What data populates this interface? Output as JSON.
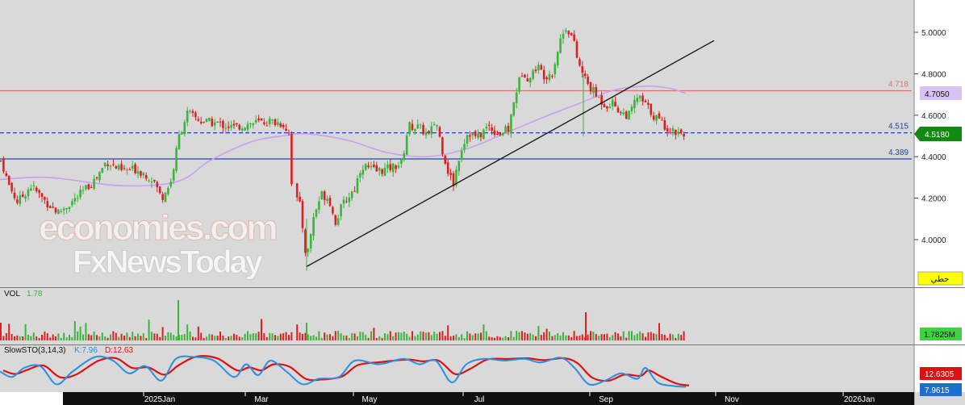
{
  "colors": {
    "background": "#d9d9d9",
    "axis_panel": "#ffffff",
    "up": "#3cb43c",
    "down": "#dc2020",
    "ma_line": "#c8a0f0",
    "resistance": "#e07070",
    "support": "#2244aa",
    "stoch_k": "#2a8fe0",
    "stoch_d": "#dd1111",
    "trendline": "#111111",
    "badge_last": "#128a12",
    "badge_ma": "#d8c4f4",
    "badge_yellow": "#ffff00"
  },
  "price_panel": {
    "axis_ticks": [
      "5.0000",
      "4.8000",
      "4.6000",
      "4.4000",
      "4.2000",
      "4.0000"
    ],
    "hlines": [
      {
        "value": 4.718,
        "label": "4.718",
        "style": "solid",
        "color": "#e07070"
      },
      {
        "value": 4.515,
        "label": "4.515",
        "style": "dashed",
        "color": "#2244aa"
      },
      {
        "value": 4.389,
        "label": "4.389",
        "style": "solid",
        "color": "#2244aa"
      }
    ],
    "badges": {
      "ma_value": "4.7050",
      "last_price": "4.5180",
      "button_text": "خطي"
    }
  },
  "volume_panel": {
    "title": "VOL",
    "value": "1.78",
    "badge": "1.7825M"
  },
  "stoch_panel": {
    "title": "SlowSTO(3,14,3)",
    "k_label": "K:7.96",
    "d_label": "D:12.63",
    "k_badge": "7.9615",
    "d_badge": "12.6305"
  },
  "x_axis": {
    "labels": [
      "2025Jan",
      "Mar",
      "May",
      "Jul",
      "Sep",
      "Nov",
      "2026Jan"
    ]
  },
  "watermark": {
    "line1": "economies.com",
    "line2": "FxNewsToday"
  },
  "chart_data": {
    "type": "candlestick",
    "x_axis": {
      "start": "2024-11",
      "end": "2026-01",
      "labels": [
        "2025Jan",
        "Mar",
        "May",
        "Jul",
        "Sep",
        "Nov",
        "2026Jan"
      ]
    },
    "y_range": [
      3.84,
      5.08
    ],
    "close_anchors": [
      {
        "x": 2,
        "close": 4.38
      },
      {
        "x": 10,
        "close": 4.27
      },
      {
        "x": 22,
        "close": 4.18
      },
      {
        "x": 38,
        "close": 4.26
      },
      {
        "x": 55,
        "close": 4.19
      },
      {
        "x": 72,
        "close": 4.13
      },
      {
        "x": 95,
        "close": 4.2
      },
      {
        "x": 120,
        "close": 4.3
      },
      {
        "x": 132,
        "close": 4.38
      },
      {
        "x": 150,
        "close": 4.33
      },
      {
        "x": 170,
        "close": 4.34
      },
      {
        "x": 190,
        "close": 4.29
      },
      {
        "x": 200,
        "close": 4.2
      },
      {
        "x": 212,
        "close": 4.28
      },
      {
        "x": 222,
        "close": 4.5
      },
      {
        "x": 232,
        "close": 4.61
      },
      {
        "x": 250,
        "close": 4.57
      },
      {
        "x": 270,
        "close": 4.56
      },
      {
        "x": 290,
        "close": 4.54
      },
      {
        "x": 310,
        "close": 4.56
      },
      {
        "x": 335,
        "close": 4.57
      },
      {
        "x": 350,
        "close": 4.56
      },
      {
        "x": 358,
        "close": 4.52
      },
      {
        "x": 362,
        "close": 4.24
      },
      {
        "x": 372,
        "close": 4.16
      },
      {
        "x": 380,
        "close": 3.9
      },
      {
        "x": 388,
        "close": 4.1
      },
      {
        "x": 398,
        "close": 4.22
      },
      {
        "x": 408,
        "close": 4.2
      },
      {
        "x": 415,
        "close": 4.08
      },
      {
        "x": 425,
        "close": 4.17
      },
      {
        "x": 440,
        "close": 4.25
      },
      {
        "x": 448,
        "close": 4.36
      },
      {
        "x": 465,
        "close": 4.33
      },
      {
        "x": 480,
        "close": 4.34
      },
      {
        "x": 498,
        "close": 4.37
      },
      {
        "x": 506,
        "close": 4.55
      },
      {
        "x": 520,
        "close": 4.54
      },
      {
        "x": 532,
        "close": 4.5
      },
      {
        "x": 540,
        "close": 4.58
      },
      {
        "x": 548,
        "close": 4.44
      },
      {
        "x": 556,
        "close": 4.32
      },
      {
        "x": 562,
        "close": 4.27
      },
      {
        "x": 570,
        "close": 4.42
      },
      {
        "x": 580,
        "close": 4.52
      },
      {
        "x": 592,
        "close": 4.49
      },
      {
        "x": 605,
        "close": 4.55
      },
      {
        "x": 618,
        "close": 4.51
      },
      {
        "x": 630,
        "close": 4.53
      },
      {
        "x": 640,
        "close": 4.72
      },
      {
        "x": 648,
        "close": 4.82
      },
      {
        "x": 656,
        "close": 4.77
      },
      {
        "x": 665,
        "close": 4.84
      },
      {
        "x": 675,
        "close": 4.79
      },
      {
        "x": 685,
        "close": 4.81
      },
      {
        "x": 694,
        "close": 4.96
      },
      {
        "x": 702,
        "close": 5.03
      },
      {
        "x": 710,
        "close": 4.97
      },
      {
        "x": 716,
        "close": 4.86
      },
      {
        "x": 722,
        "close": 4.8
      },
      {
        "x": 730,
        "close": 4.74
      },
      {
        "x": 740,
        "close": 4.69
      },
      {
        "x": 750,
        "close": 4.65
      },
      {
        "x": 760,
        "close": 4.66
      },
      {
        "x": 770,
        "close": 4.61
      },
      {
        "x": 780,
        "close": 4.6
      },
      {
        "x": 790,
        "close": 4.69
      },
      {
        "x": 800,
        "close": 4.65
      },
      {
        "x": 810,
        "close": 4.6
      },
      {
        "x": 818,
        "close": 4.57
      },
      {
        "x": 830,
        "close": 4.53
      },
      {
        "x": 840,
        "close": 4.52
      },
      {
        "x": 850,
        "close": 4.518
      }
    ],
    "moving_average": [
      {
        "x": 0,
        "value": 4.29
      },
      {
        "x": 60,
        "value": 4.3
      },
      {
        "x": 150,
        "value": 4.26
      },
      {
        "x": 220,
        "value": 4.28
      },
      {
        "x": 260,
        "value": 4.38
      },
      {
        "x": 310,
        "value": 4.47
      },
      {
        "x": 350,
        "value": 4.5
      },
      {
        "x": 380,
        "value": 4.51
      },
      {
        "x": 430,
        "value": 4.48
      },
      {
        "x": 480,
        "value": 4.42
      },
      {
        "x": 530,
        "value": 4.4
      },
      {
        "x": 580,
        "value": 4.44
      },
      {
        "x": 630,
        "value": 4.52
      },
      {
        "x": 680,
        "value": 4.6
      },
      {
        "x": 720,
        "value": 4.66
      },
      {
        "x": 760,
        "value": 4.72
      },
      {
        "x": 800,
        "value": 4.74
      },
      {
        "x": 830,
        "value": 4.73
      },
      {
        "x": 850,
        "value": 4.705
      }
    ],
    "trendline": {
      "from": {
        "x": 380,
        "value": 3.87
      },
      "to": {
        "x": 885,
        "value": 4.96
      }
    },
    "stochastic_k_anchors": [
      {
        "x": 0,
        "value": 50
      },
      {
        "x": 15,
        "value": 35
      },
      {
        "x": 30,
        "value": 60
      },
      {
        "x": 50,
        "value": 65
      },
      {
        "x": 70,
        "value": 15
      },
      {
        "x": 90,
        "value": 50
      },
      {
        "x": 118,
        "value": 90
      },
      {
        "x": 140,
        "value": 80
      },
      {
        "x": 160,
        "value": 45
      },
      {
        "x": 180,
        "value": 65
      },
      {
        "x": 200,
        "value": 25
      },
      {
        "x": 218,
        "value": 85
      },
      {
        "x": 240,
        "value": 90
      },
      {
        "x": 265,
        "value": 80
      },
      {
        "x": 290,
        "value": 35
      },
      {
        "x": 305,
        "value": 70
      },
      {
        "x": 320,
        "value": 40
      },
      {
        "x": 335,
        "value": 80
      },
      {
        "x": 355,
        "value": 50
      },
      {
        "x": 375,
        "value": 15
      },
      {
        "x": 395,
        "value": 30
      },
      {
        "x": 420,
        "value": 35
      },
      {
        "x": 440,
        "value": 80
      },
      {
        "x": 470,
        "value": 70
      },
      {
        "x": 500,
        "value": 85
      },
      {
        "x": 520,
        "value": 70
      },
      {
        "x": 540,
        "value": 80
      },
      {
        "x": 560,
        "value": 20
      },
      {
        "x": 578,
        "value": 70
      },
      {
        "x": 600,
        "value": 85
      },
      {
        "x": 625,
        "value": 80
      },
      {
        "x": 650,
        "value": 85
      },
      {
        "x": 670,
        "value": 75
      },
      {
        "x": 695,
        "value": 88
      },
      {
        "x": 712,
        "value": 60
      },
      {
        "x": 730,
        "value": 15
      },
      {
        "x": 750,
        "value": 25
      },
      {
        "x": 770,
        "value": 45
      },
      {
        "x": 790,
        "value": 30
      },
      {
        "x": 800,
        "value": 60
      },
      {
        "x": 815,
        "value": 20
      },
      {
        "x": 835,
        "value": 10
      },
      {
        "x": 850,
        "value": 8
      }
    ],
    "stochastic_k_last": 7.96,
    "stochastic_d_last": 12.63,
    "volume_last": "1.78"
  }
}
